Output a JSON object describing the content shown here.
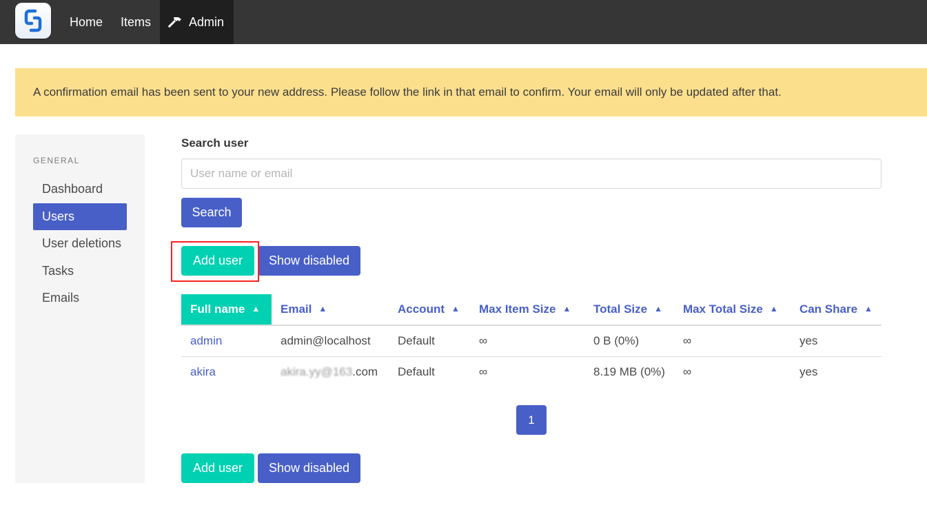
{
  "nav": {
    "logo": "sync-logo-icon",
    "items": [
      {
        "label": "Home"
      },
      {
        "label": "Items"
      },
      {
        "label": "Admin",
        "icon": "hammer-icon",
        "active": true
      }
    ]
  },
  "notification": {
    "text": "A confirmation email has been sent to your new address. Please follow the link in that email to confirm. Your email will only be updated after that."
  },
  "sidebar": {
    "section_label": "GENERAL",
    "items": [
      {
        "label": "Dashboard"
      },
      {
        "label": "Users",
        "active": true
      },
      {
        "label": "User deletions"
      },
      {
        "label": "Tasks"
      },
      {
        "label": "Emails"
      }
    ]
  },
  "search": {
    "label": "Search user",
    "placeholder": "User name or email",
    "value": "",
    "button_label": "Search"
  },
  "actions": {
    "add_user_label": "Add user",
    "show_disabled_label": "Show disabled"
  },
  "table": {
    "columns": [
      {
        "label": "Full name",
        "sorted": true
      },
      {
        "label": "Email"
      },
      {
        "label": "Account"
      },
      {
        "label": "Max Item Size"
      },
      {
        "label": "Total Size"
      },
      {
        "label": "Max Total Size"
      },
      {
        "label": "Can Share"
      }
    ],
    "sort_arrow": "▲",
    "rows": [
      {
        "full_name": "admin",
        "email": "admin@localhost",
        "account": "Default",
        "max_item_size": "∞",
        "total_size": "0 B (0%)",
        "max_total_size": "∞",
        "can_share": "yes"
      },
      {
        "full_name": "akira",
        "email_hidden": "akira.yy@163",
        "email_visible": "com",
        "account": "Default",
        "max_item_size": "∞",
        "total_size": "8.19 MB (0%)",
        "max_total_size": "∞",
        "can_share": "yes"
      }
    ]
  },
  "pagination": {
    "current_page": "1"
  },
  "colors": {
    "navbar": "#363636",
    "primary": "#485fc7",
    "success": "#00d1b2",
    "warning": "#fcdf8d",
    "highlight": "#ff2020"
  }
}
